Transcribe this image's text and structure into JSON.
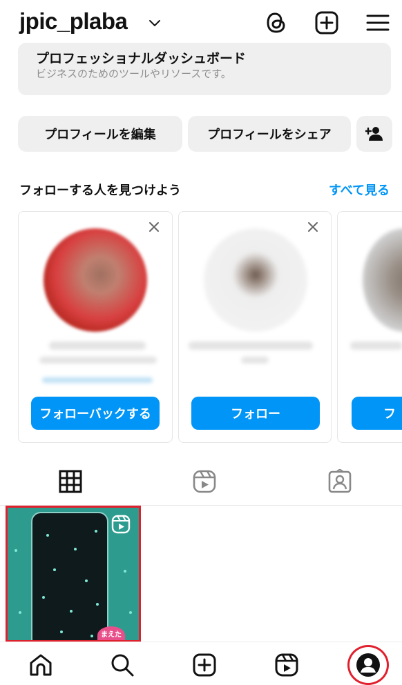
{
  "header": {
    "username": "jpic_plaba"
  },
  "dashboard": {
    "title": "プロフェッショナルダッシュボード",
    "subtitle": "ビジネスのためのツールやリソースです。"
  },
  "actions": {
    "edit_profile": "プロフィールを編集",
    "share_profile": "プロフィールをシェア"
  },
  "suggestions": {
    "title": "フォローする人を見つけよう",
    "see_all": "すべて見る",
    "cards": [
      {
        "button": "フォローバックする"
      },
      {
        "button": "フォロー"
      },
      {
        "button": "フ"
      }
    ]
  },
  "thumbnail": {
    "sticker_text": "まえた"
  },
  "colors": {
    "accent": "#0095f6",
    "highlight": "#e1202d",
    "surface": "#efefef"
  },
  "icons": {
    "header": [
      "threads-icon",
      "add-post-icon",
      "menu-icon"
    ],
    "tabs": [
      "grid-icon",
      "reels-icon",
      "tagged-icon"
    ],
    "nav": [
      "home-icon",
      "search-icon",
      "create-icon",
      "reels-icon",
      "profile-icon"
    ]
  }
}
